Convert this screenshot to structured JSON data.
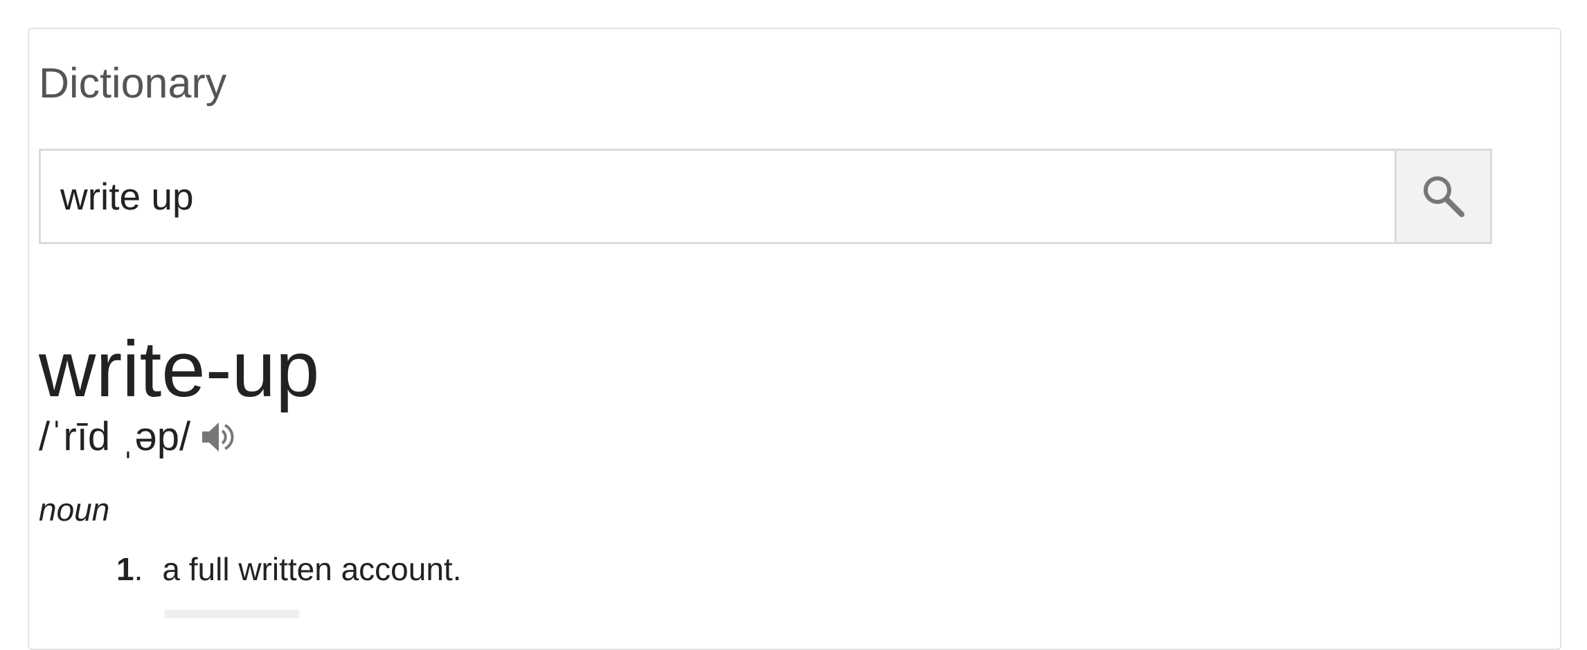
{
  "card": {
    "title": "Dictionary"
  },
  "search": {
    "value": "write up",
    "button_icon": "search-icon"
  },
  "entry": {
    "headword": "write-up",
    "pronunciation": "/ˈrīd ˌəp/",
    "audio_icon": "speaker-icon",
    "part_of_speech": "noun",
    "definitions": [
      {
        "number": "1",
        "text": "a full written account."
      }
    ]
  },
  "colors": {
    "border": "#e3e3e3",
    "title_text": "#555555",
    "body_text": "#222222",
    "button_bg": "#f2f2f2",
    "icon": "#777777"
  }
}
